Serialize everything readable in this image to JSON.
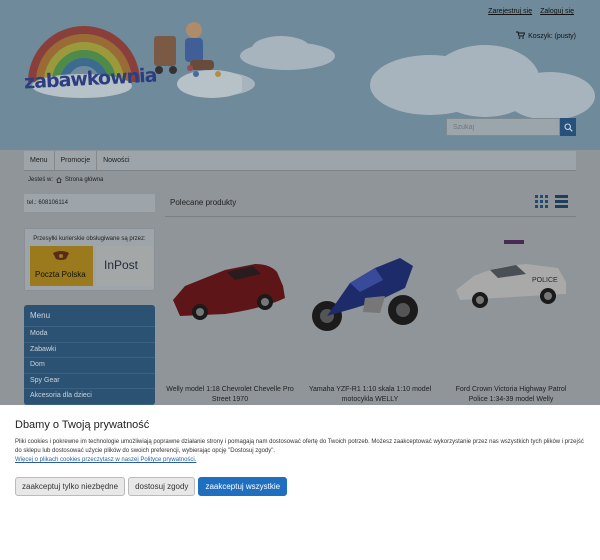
{
  "header": {
    "register_link": "Zarejestruj się",
    "login_link": "Zaloguj się",
    "cart_label": "Koszyk: (pusty)",
    "logo_text": "zabawkownia"
  },
  "search": {
    "placeholder": "Szukaj"
  },
  "nav": {
    "items": [
      "Menu",
      "Promocje",
      "Nowości"
    ]
  },
  "breadcrumb": {
    "prefix": "Jesteś w:",
    "current": "Strona główna"
  },
  "sidebar": {
    "phone": "tel.: 608106114",
    "couriers_title": "Przesyłki kurierskie obsługiwane są przez:",
    "poczta_polska": "Poczta Polska",
    "inpost": "InPost",
    "menu_title": "Menu",
    "menu_items": [
      "Moda",
      "Zabawki",
      "Dom",
      "Spy Gear",
      "Akcesoria dla dzieci"
    ]
  },
  "main": {
    "section_title": "Polecane produkty",
    "products": [
      {
        "name": "Welly model 1:18 Chevrolet Chevelle Pro Street 1970"
      },
      {
        "name": "Yamaha YZF-R1 1:10 skala 1:10 model motocykla WELLY"
      },
      {
        "name": "Ford Crown Victoria Highway Patrol Police 1:34-39 model Welly"
      }
    ],
    "police_label": "POLICE"
  },
  "cookie": {
    "title": "Dbamy o Twoją prywatność",
    "text": "Pliki cookies i pokrewne im technologie umożliwiają poprawne działanie strony i pomagają nam dostosować ofertę do Twoich potrzeb. Możesz zaakceptować wykorzystanie przez nas wszystkich tych plików i przejść do sklepu lub dostosować użycie plików do swoich preferencji, wybierając opcję \"Dostosuj zgody\".",
    "link": "Więcej o plikach cookies przeczytasz w naszej Polityce prywatności.",
    "btn_necessary": "zaakceptuj tylko niezbędne",
    "btn_customize": "dostosuj zgody",
    "btn_accept_all": "zaakceptuj wszystkie"
  },
  "colors": {
    "primary_button": "#1e6fc0",
    "menu_bg": "#2c5273"
  }
}
